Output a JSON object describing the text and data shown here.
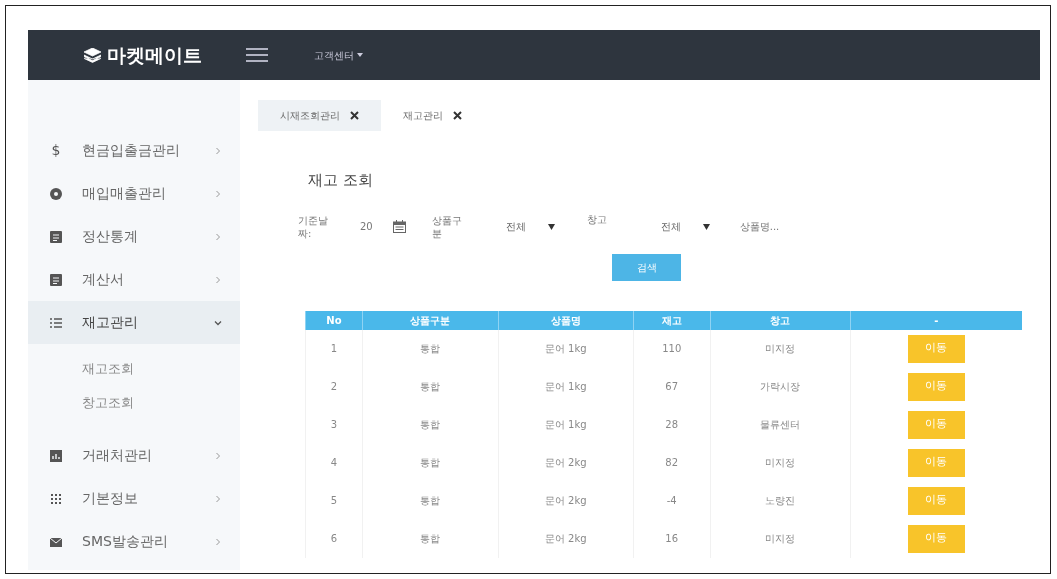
{
  "navbar": {
    "brand": "마켓메이트",
    "menu": "고객센터"
  },
  "sidebar": {
    "items": [
      {
        "symbol": "$",
        "label": "현금입출금관리",
        "expanded": false,
        "selected": false
      },
      {
        "label": "매입매출관리",
        "expanded": false,
        "selected": false
      },
      {
        "label": "정산통계",
        "expanded": false,
        "selected": false
      },
      {
        "label": "계산서",
        "expanded": false,
        "selected": false
      },
      {
        "label": "재고관리",
        "expanded": true,
        "selected": true,
        "children": [
          {
            "label": "재고조회"
          },
          {
            "label": "창고조회"
          }
        ]
      },
      {
        "label": "거래처관리",
        "expanded": false,
        "selected": false
      },
      {
        "label": "기본정보",
        "expanded": false,
        "selected": false
      },
      {
        "label": "SMS발송관리",
        "expanded": false,
        "selected": false
      }
    ]
  },
  "tabs": [
    {
      "label": "시재조회관리",
      "selected": false
    },
    {
      "label": "재고관리",
      "selected": true
    }
  ],
  "title": "재고 조회",
  "filters": {
    "date_label": "기준날짜:",
    "date_value": "20",
    "category_label": "상품구분",
    "category_value": "전체",
    "warehouse_label": "창고",
    "warehouse_value": "전체",
    "search": {
      "placeholder": "상품명..."
    },
    "button": "검색"
  },
  "table": {
    "columns": [
      "No",
      "상품구분",
      "상품명",
      "재고",
      "창고",
      "-"
    ],
    "rows": [
      {
        "cells": [
          "1",
          "통합",
          "문어 1kg",
          "110",
          "미지정"
        ],
        "action": "이동"
      },
      {
        "cells": [
          "2",
          "통합",
          "문어 1kg",
          "67",
          "가락시장"
        ],
        "action": "이동"
      },
      {
        "cells": [
          "3",
          "통합",
          "문어 1kg",
          "28",
          "물류센터"
        ],
        "action": "이동"
      },
      {
        "cells": [
          "4",
          "통합",
          "문어 2kg",
          "82",
          "미지정"
        ],
        "action": "이동"
      },
      {
        "cells": [
          "5",
          "통합",
          "문어 2kg",
          "-4",
          "노량진"
        ],
        "action": "이동"
      },
      {
        "cells": [
          "6",
          "통합",
          "문어 2kg",
          "16",
          "미지정"
        ],
        "action": "이동"
      }
    ]
  }
}
